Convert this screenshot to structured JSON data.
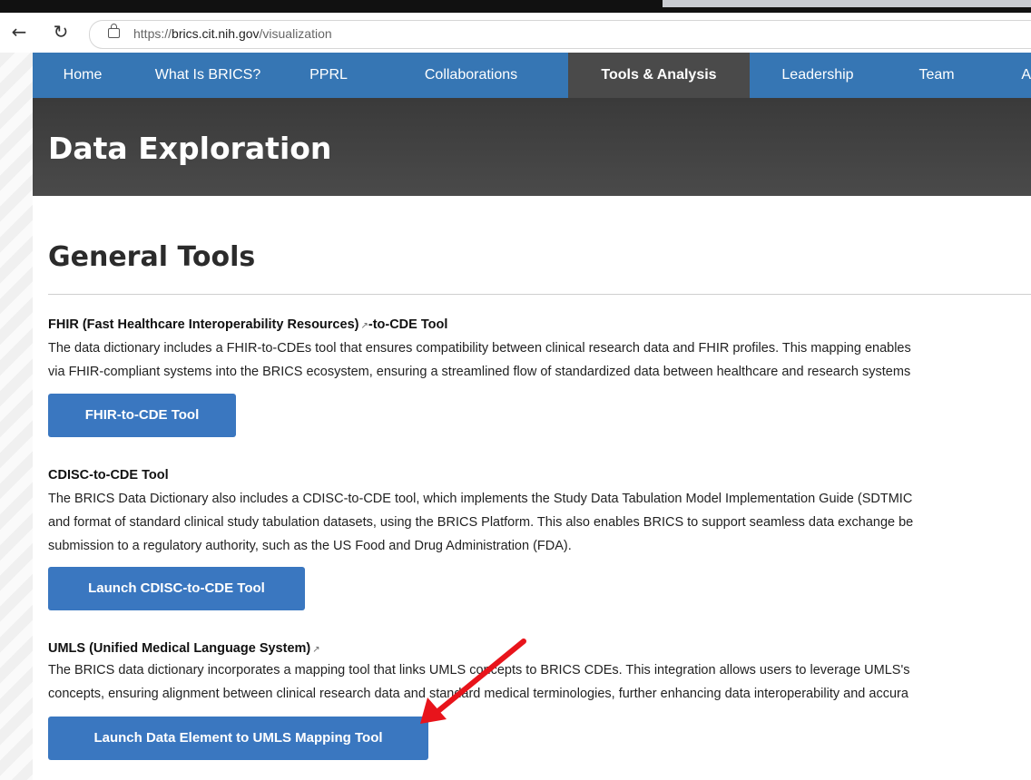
{
  "browser": {
    "url_prefix": "https://",
    "url_domain": "brics.cit.nih.gov",
    "url_path": "/visualization",
    "back_icon": "back-arrow-icon",
    "reload_icon": "reload-icon",
    "lock_icon": "lock-icon"
  },
  "nav": {
    "items": [
      {
        "label": "Home"
      },
      {
        "label": "What Is BRICS?"
      },
      {
        "label": "PPRL"
      },
      {
        "label": "Collaborations"
      },
      {
        "label": "Tools & Analysis",
        "active": true
      },
      {
        "label": "Leadership"
      },
      {
        "label": "Team"
      },
      {
        "label": "A"
      }
    ]
  },
  "hero": {
    "title": "Data Exploration"
  },
  "general_tools": {
    "heading": "General Tools",
    "sections": [
      {
        "title_before_icon": "FHIR (Fast Healthcare Interoperability Resources)",
        "title_after_icon": "-to-CDE Tool",
        "line1": "The data dictionary includes a FHIR-to-CDEs tool that ensures compatibility between clinical research data and FHIR profiles. This mapping enables",
        "line2": "via FHIR-compliant systems into the BRICS ecosystem, ensuring a streamlined flow of standardized data between healthcare and research systems",
        "button": "FHIR-to-CDE Tool"
      },
      {
        "title": "CDISC-to-CDE Tool",
        "line1": "The BRICS Data Dictionary also includes a CDISC-to-CDE tool, which implements the Study Data Tabulation Model Implementation Guide (SDTMIC",
        "line2": "and format of standard clinical study tabulation datasets, using the BRICS Platform. This also enables BRICS to support seamless data exchange be",
        "line3": "submission to a regulatory authority, such as the US Food and Drug Administration (FDA).",
        "button": "Launch CDISC-to-CDE Tool"
      },
      {
        "title": "UMLS (Unified Medical Language System)",
        "line1": "The BRICS data dictionary incorporates a mapping tool that links UMLS concepts to BRICS CDEs. This integration allows users to leverage UMLS's",
        "line2": "concepts, ensuring alignment between clinical research data and standard medical terminologies, further enhancing data interoperability and accura",
        "button": "Launch Data Element to UMLS Mapping Tool"
      }
    ]
  },
  "colors": {
    "nav_blue": "#3676b4",
    "nav_active": "#4a4a4a",
    "button_blue": "#3a77c0",
    "annotation_arrow": "#e8141b"
  }
}
